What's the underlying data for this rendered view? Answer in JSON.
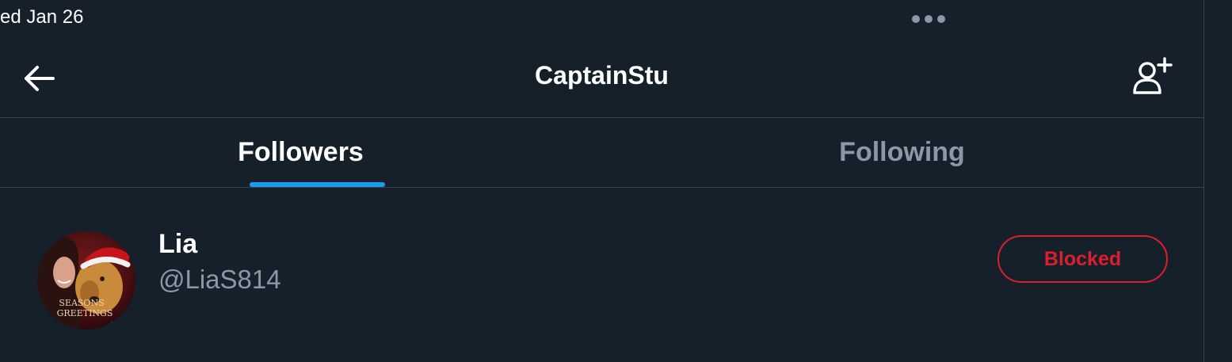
{
  "status_bar": {
    "time": "ed Jan 26"
  },
  "header": {
    "title": "CaptainStu",
    "back_icon": "arrow-left-icon",
    "add_icon": "add-user-icon"
  },
  "tabs": [
    {
      "label": "Followers",
      "active": true
    },
    {
      "label": "Following",
      "active": false
    }
  ],
  "users": [
    {
      "name": "Lia",
      "handle": "@LiaS814",
      "avatar_text": [
        "SEASONS",
        "GREETINGS"
      ],
      "button_label": "Blocked"
    }
  ],
  "colors": {
    "background": "#15202b",
    "divider": "#38444d",
    "accent": "#1d9bf0",
    "blocked": "#dc1e2d",
    "muted_text": "#8b98a5"
  }
}
